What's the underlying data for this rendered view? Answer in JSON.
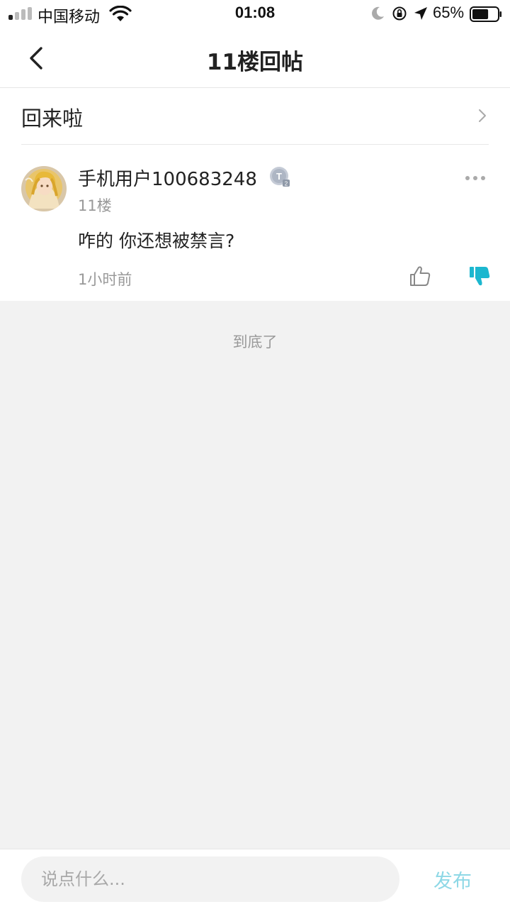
{
  "status_bar": {
    "carrier": "中国移动",
    "time": "01:08",
    "battery_percent": "65%",
    "signal_bars_active": 1,
    "battery_level": 0.65
  },
  "nav": {
    "title": "11楼回帖",
    "back_icon": "chevron-left-icon"
  },
  "thread": {
    "title": "回来啦",
    "chevron_icon": "chevron-right-icon"
  },
  "post": {
    "username": "手机用户100683248",
    "level_badge": "T2",
    "floor": "11楼",
    "content": "咋的 你还想被禁言?",
    "time": "1小时前",
    "more_icon": "more-dots-icon",
    "like_icon": "thumbs-up-outline-icon",
    "dislike_icon": "thumbs-down-filled-icon",
    "dislike_active": true,
    "accent_color": "#1cb7cf"
  },
  "footer_text": "到底了",
  "comment_bar": {
    "placeholder": "说点什么...",
    "publish_label": "发布",
    "publish_color": "#8ed8e6"
  }
}
